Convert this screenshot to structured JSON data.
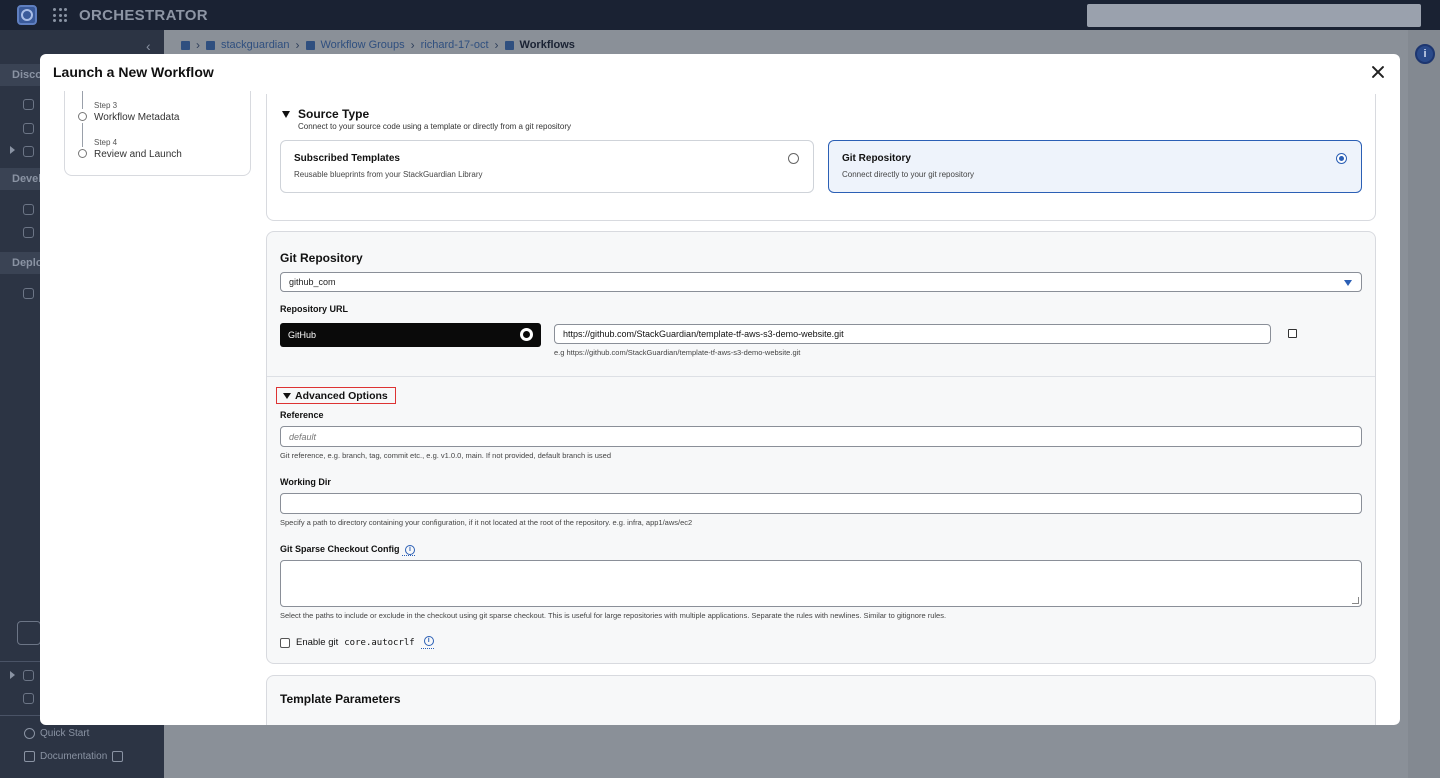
{
  "app": {
    "brand": "ORCHESTRATOR"
  },
  "sidebar": {
    "sections": [
      "Disco",
      "Devel",
      "Deplo"
    ],
    "footer": {
      "quick_start": "Quick Start",
      "documentation": "Documentation"
    }
  },
  "breadcrumb": {
    "items": [
      "stackguardian",
      "Workflow Groups",
      "richard-17-oct",
      "Workflows"
    ]
  },
  "modal": {
    "title": "Launch a New Workflow",
    "steps": [
      {
        "num": "Step 3",
        "name": "Workflow Metadata"
      },
      {
        "num": "Step 4",
        "name": "Review and Launch"
      }
    ],
    "source_type": {
      "heading": "Source Type",
      "subtitle": "Connect to your source code using a template or directly from a git repository",
      "options": [
        {
          "title": "Subscribed Templates",
          "desc": "Reusable blueprints from your StackGuardian Library",
          "selected": false
        },
        {
          "title": "Git Repository",
          "desc": "Connect directly to your git repository",
          "selected": true
        }
      ]
    },
    "git": {
      "heading": "Git Repository",
      "integration_value": "github_com",
      "repo_url_label": "Repository URL",
      "provider": "GitHub",
      "repo_url_value": "https://github.com/StackGuardian/template-tf-aws-s3-demo-website.git",
      "repo_url_hint": "e.g https://github.com/StackGuardian/template-tf-aws-s3-demo-website.git",
      "advanced_label": "Advanced Options",
      "reference_label": "Reference",
      "reference_placeholder": "default",
      "reference_hint": "Git reference, e.g. branch, tag, commit etc., e.g. v1.0.0, main. If not provided, default branch is used",
      "working_dir_label": "Working Dir",
      "working_dir_hint": "Specify a path to directory containing your configuration, if it not located at the root of the repository. e.g. infra, app1/aws/ec2",
      "sparse_label": "Git Sparse Checkout Config",
      "sparse_hint": "Select the paths to include or exclude in the checkout using git sparse checkout. This is useful for large repositories with multiple applications. Separate the rules with newlines. Similar to gitignore rules.",
      "autocrlf_prefix": "Enable git",
      "autocrlf_code": "core.autocrlf"
    },
    "template_params": {
      "heading": "Template Parameters"
    }
  },
  "colors": {
    "accent": "#2b5fb5",
    "highlight_border": "#dd3333",
    "topbar": "#1a2233"
  }
}
